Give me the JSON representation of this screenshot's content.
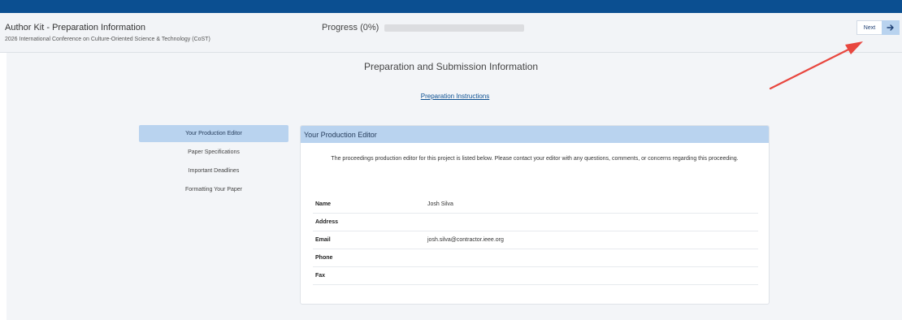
{
  "header": {
    "title": "Author Kit - Preparation Information",
    "conference": "2026 International Conference on Culture-Oriented Science & Technology (CoST)",
    "progress_label": "Progress (0%)",
    "progress_value": 0,
    "next_label": "Next"
  },
  "main": {
    "title": "Preparation and Submission Information",
    "instructions_link": "Preparation Instructions"
  },
  "nav": {
    "items": [
      {
        "label": "Your Production Editor",
        "active": true
      },
      {
        "label": "Paper Specifications"
      },
      {
        "label": "Important Deadlines"
      },
      {
        "label": "Formatting Your Paper"
      }
    ]
  },
  "panel": {
    "title": "Your Production Editor",
    "description": "The proceedings production editor for this project is listed below. Please contact your editor with any questions, comments, or concerns regarding this proceeding.",
    "rows": [
      {
        "label": "Name",
        "value": "Josh Silva"
      },
      {
        "label": "Address",
        "value": ""
      },
      {
        "label": "Email",
        "value": "josh.silva@contractor.ieee.org"
      },
      {
        "label": "Phone",
        "value": ""
      },
      {
        "label": "Fax",
        "value": ""
      }
    ]
  },
  "colors": {
    "brand_blue": "#0b4f91",
    "highlight_blue": "#b9d3ef",
    "annotation_red": "#e8473f"
  },
  "icons": {
    "next": "arrow-right-icon",
    "annotation": "red-arrow-annotation"
  }
}
